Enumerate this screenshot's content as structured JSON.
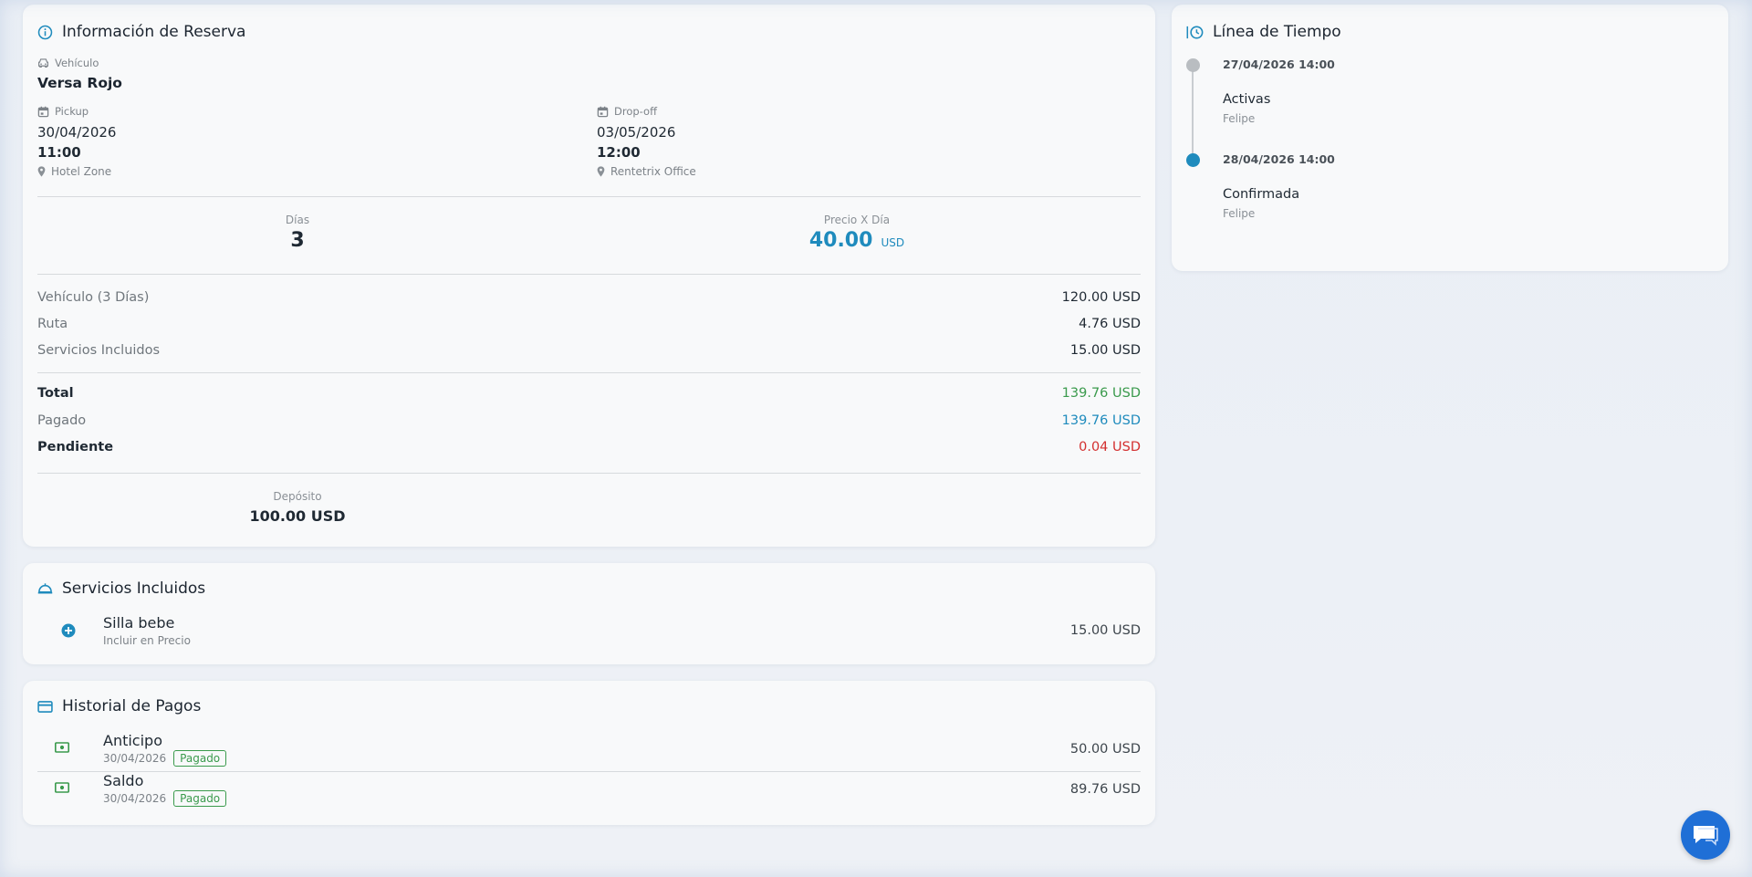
{
  "reservation": {
    "title": "Información de Reserva",
    "vehicle_label": "Vehículo",
    "vehicle_value": "Versa Rojo",
    "pickup": {
      "label": "Pickup",
      "date": "30/04/2026",
      "time": "11:00",
      "location": "Hotel Zone"
    },
    "dropoff": {
      "label": "Drop-off",
      "date": "03/05/2026",
      "time": "12:00",
      "location": "Rentetrix Office"
    },
    "days_label": "Días",
    "days_value": "3",
    "price_label": "Precio X Día",
    "price_value": "40.00",
    "price_currency": "USD",
    "lines": [
      {
        "label": "Vehículo (3 Días)",
        "value": "120.00 USD"
      },
      {
        "label": "Ruta",
        "value": "4.76 USD"
      },
      {
        "label": "Servicios Incluidos",
        "value": "15.00 USD"
      }
    ],
    "total_label": "Total",
    "total_value": "139.76 USD",
    "paid_label": "Pagado",
    "paid_value": "139.76 USD",
    "pending_label": "Pendiente",
    "pending_value": "0.04 USD",
    "deposit_label": "Depósito",
    "deposit_value": "100.00 USD"
  },
  "services": {
    "title": "Servicios Incluidos",
    "items": [
      {
        "name": "Silla bebe",
        "sub": "Incluir en Precio",
        "amount": "15.00 USD"
      }
    ]
  },
  "payments": {
    "title": "Historial de Pagos",
    "items": [
      {
        "name": "Anticipo",
        "date": "30/04/2026",
        "status": "Pagado",
        "amount": "50.00 USD"
      },
      {
        "name": "Saldo",
        "date": "30/04/2026",
        "status": "Pagado",
        "amount": "89.76 USD"
      }
    ]
  },
  "timeline": {
    "title": "Línea de Tiempo",
    "events": [
      {
        "datetime": "27/04/2026 14:00",
        "status": "Activas",
        "user": "Felipe"
      },
      {
        "datetime": "28/04/2026 14:00",
        "status": "Confirmada",
        "user": "Felipe"
      }
    ]
  },
  "colors": {
    "accent": "#1f8bbd",
    "total_green": "#3a9a4c",
    "paid_blue": "#1f8bbd",
    "pending_red": "#d32f2f",
    "chat_button": "#1f6fd6"
  },
  "icons": {
    "reservation": "info-circle-icon",
    "vehicle": "car-icon",
    "pickup": "calendar-icon",
    "dropoff": "calendar-icon",
    "location": "map-pin-icon",
    "services": "service-bell-icon",
    "service_item": "plus-circle-icon",
    "payments": "credit-card-icon",
    "payment_item": "cash-icon",
    "timeline": "history-icon",
    "chat": "chat-icon"
  }
}
